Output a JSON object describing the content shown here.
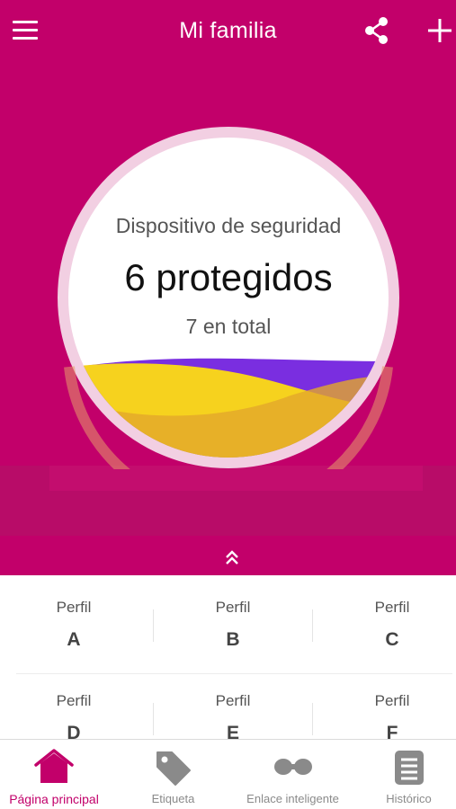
{
  "header": {
    "title": "Mi familia",
    "menu_icon": "hamburger-menu-icon",
    "share_icon": "share-icon",
    "add_icon": "plus-icon"
  },
  "summary": {
    "subtitle": "Dispositivo de seguridad",
    "protected_text": "6 protegidos",
    "total_text": "7 en total",
    "protected_count": 6,
    "total_count": 7
  },
  "expand_icon": "double-chevron-up-icon",
  "profiles": [
    {
      "label": "Perfil",
      "letter": "A"
    },
    {
      "label": "Perfil",
      "letter": "B"
    },
    {
      "label": "Perfil",
      "letter": "C"
    },
    {
      "label": "Perfil",
      "letter": "D"
    },
    {
      "label": "Perfil",
      "letter": "E"
    },
    {
      "label": "Perfil",
      "letter": "F"
    }
  ],
  "nav": [
    {
      "label": "Página principal",
      "icon": "home-icon",
      "active": true
    },
    {
      "label": "Etiqueta",
      "icon": "tag-icon",
      "active": false
    },
    {
      "label": "Enlace inteligente",
      "icon": "link-icon",
      "active": false
    },
    {
      "label": "Histórico",
      "icon": "history-icon",
      "active": false
    }
  ],
  "colors": {
    "primary": "#c2006a",
    "wave_yellow": "#f4cc1c",
    "wave_purple": "#7a2ee0",
    "nav_inactive": "#8a8a8a"
  }
}
